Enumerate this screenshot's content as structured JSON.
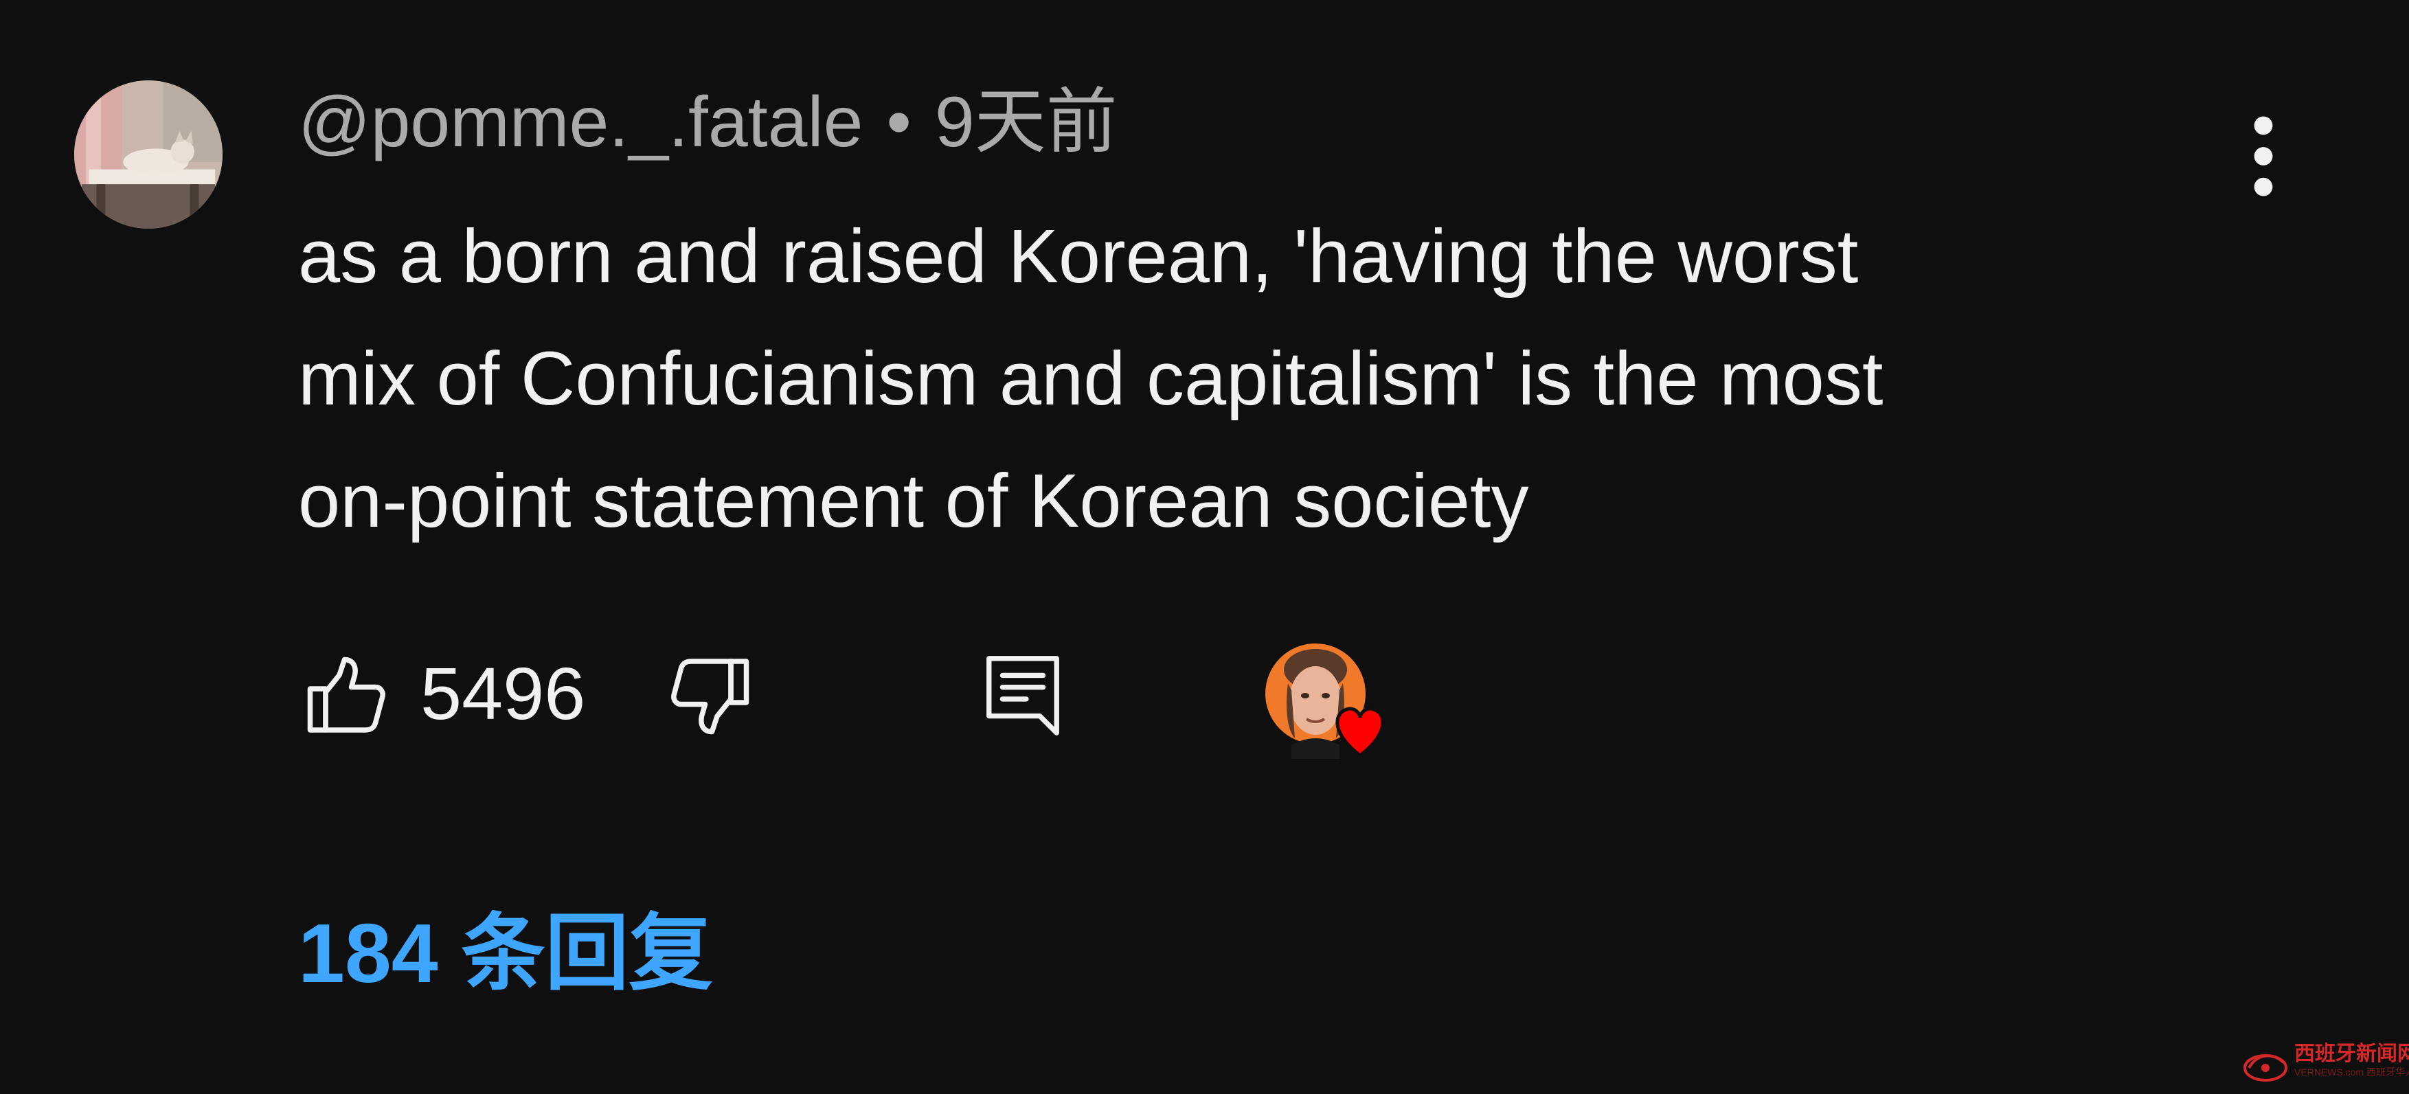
{
  "comment": {
    "author": "@pomme._.fatale",
    "separator": "•",
    "time": "9天前",
    "text": "as a born and raised Korean, 'having the worst\nmix of Confucianism and capitalism' is the most\non-point statement of Korean society",
    "like_count": "5496",
    "replies_label": "184 条回复"
  },
  "icons": {
    "avatar": "user-avatar-cat",
    "more": "more-vert-icon",
    "like": "thumb-up-icon",
    "dislike": "thumb-down-icon",
    "reply": "reply-comment-icon",
    "creator_heart": "creator-heart-avatar"
  },
  "colors": {
    "background": "#0f0f0f",
    "text": "#f1f1f1",
    "secondary_text": "#aaaaaa",
    "link_blue": "#3ea6ff",
    "heart_red": "#ff0000"
  },
  "watermark": {
    "title": "西班牙新闻网",
    "subtitle": "VERNEWS.com 西班牙华人网"
  }
}
